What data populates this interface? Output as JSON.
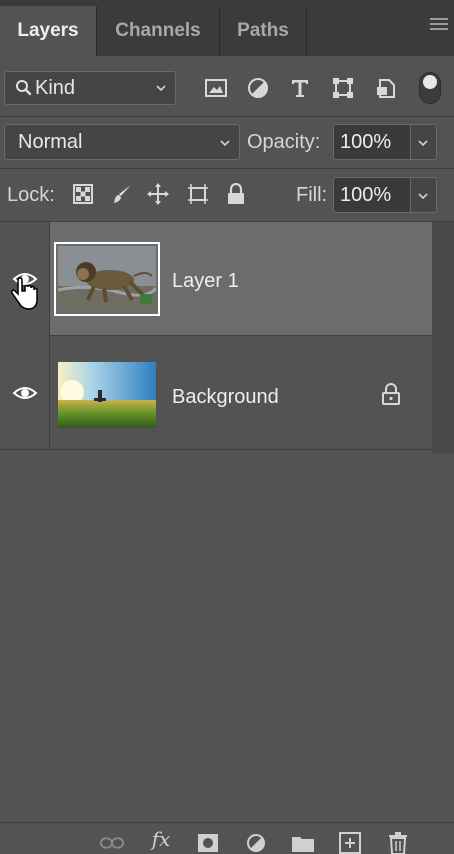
{
  "tabs": [
    {
      "label": "Layers",
      "active": true
    },
    {
      "label": "Channels",
      "active": false
    },
    {
      "label": "Paths",
      "active": false
    }
  ],
  "filter": {
    "kind_label": "Kind",
    "icons": [
      "image-filter-icon",
      "adjustment-filter-icon",
      "type-filter-icon",
      "shape-filter-icon",
      "smart-object-filter-icon"
    ]
  },
  "blend": {
    "mode": "Normal",
    "opacity_label": "Opacity:",
    "opacity_value": "100%"
  },
  "lock": {
    "label": "Lock:",
    "icons": [
      "lock-transparent-pixels-icon",
      "lock-image-pixels-icon",
      "lock-position-icon",
      "lock-artboard-icon",
      "lock-all-icon"
    ],
    "fill_label": "Fill:",
    "fill_value": "100%"
  },
  "layers": [
    {
      "name": "Layer 1",
      "selected": true,
      "visible": true,
      "locked": false,
      "thumb": "lion-thumbnail"
    },
    {
      "name": "Background",
      "selected": false,
      "visible": true,
      "locked": true,
      "thumb": "landscape-thumbnail"
    }
  ],
  "bottom_toolbar": {
    "fx_label": "fx",
    "icons": [
      "link-layers-icon",
      "fx-icon",
      "add-mask-icon",
      "adjustment-layer-icon",
      "new-group-icon",
      "new-layer-icon",
      "delete-layer-icon"
    ]
  },
  "colors": {
    "panel_bg": "#535353",
    "tab_bg": "#3b3b3b",
    "selected_row": "#6c6c6c",
    "text": "#eeeeee"
  }
}
